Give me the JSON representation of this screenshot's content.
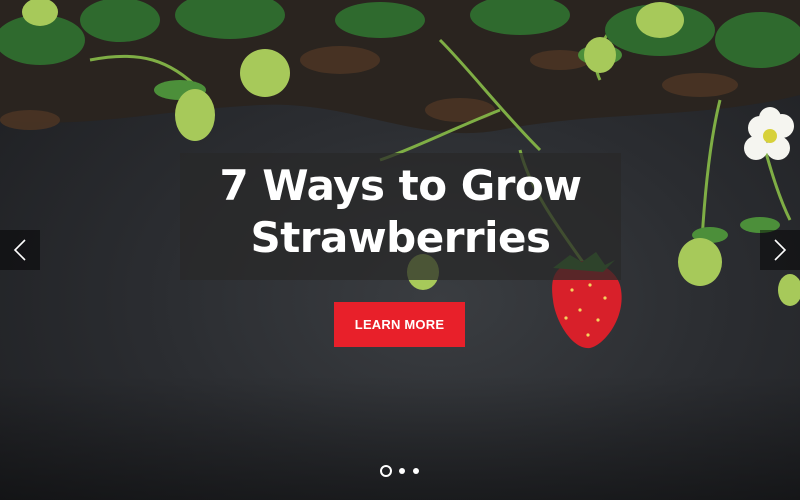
{
  "slide": {
    "headline_line1": "7 Ways to Grow",
    "headline_line2": "Strawberries",
    "cta_label": "LEARN MORE"
  },
  "navigation": {
    "prev_icon": "chevron-left-icon",
    "next_icon": "chevron-right-icon",
    "slide_count": 3,
    "active_slide": 1
  },
  "colors": {
    "accent": "#e8202a",
    "text": "#ffffff",
    "headline_backdrop": "rgba(40,40,40,0.72)",
    "background": "#2b2d31"
  }
}
